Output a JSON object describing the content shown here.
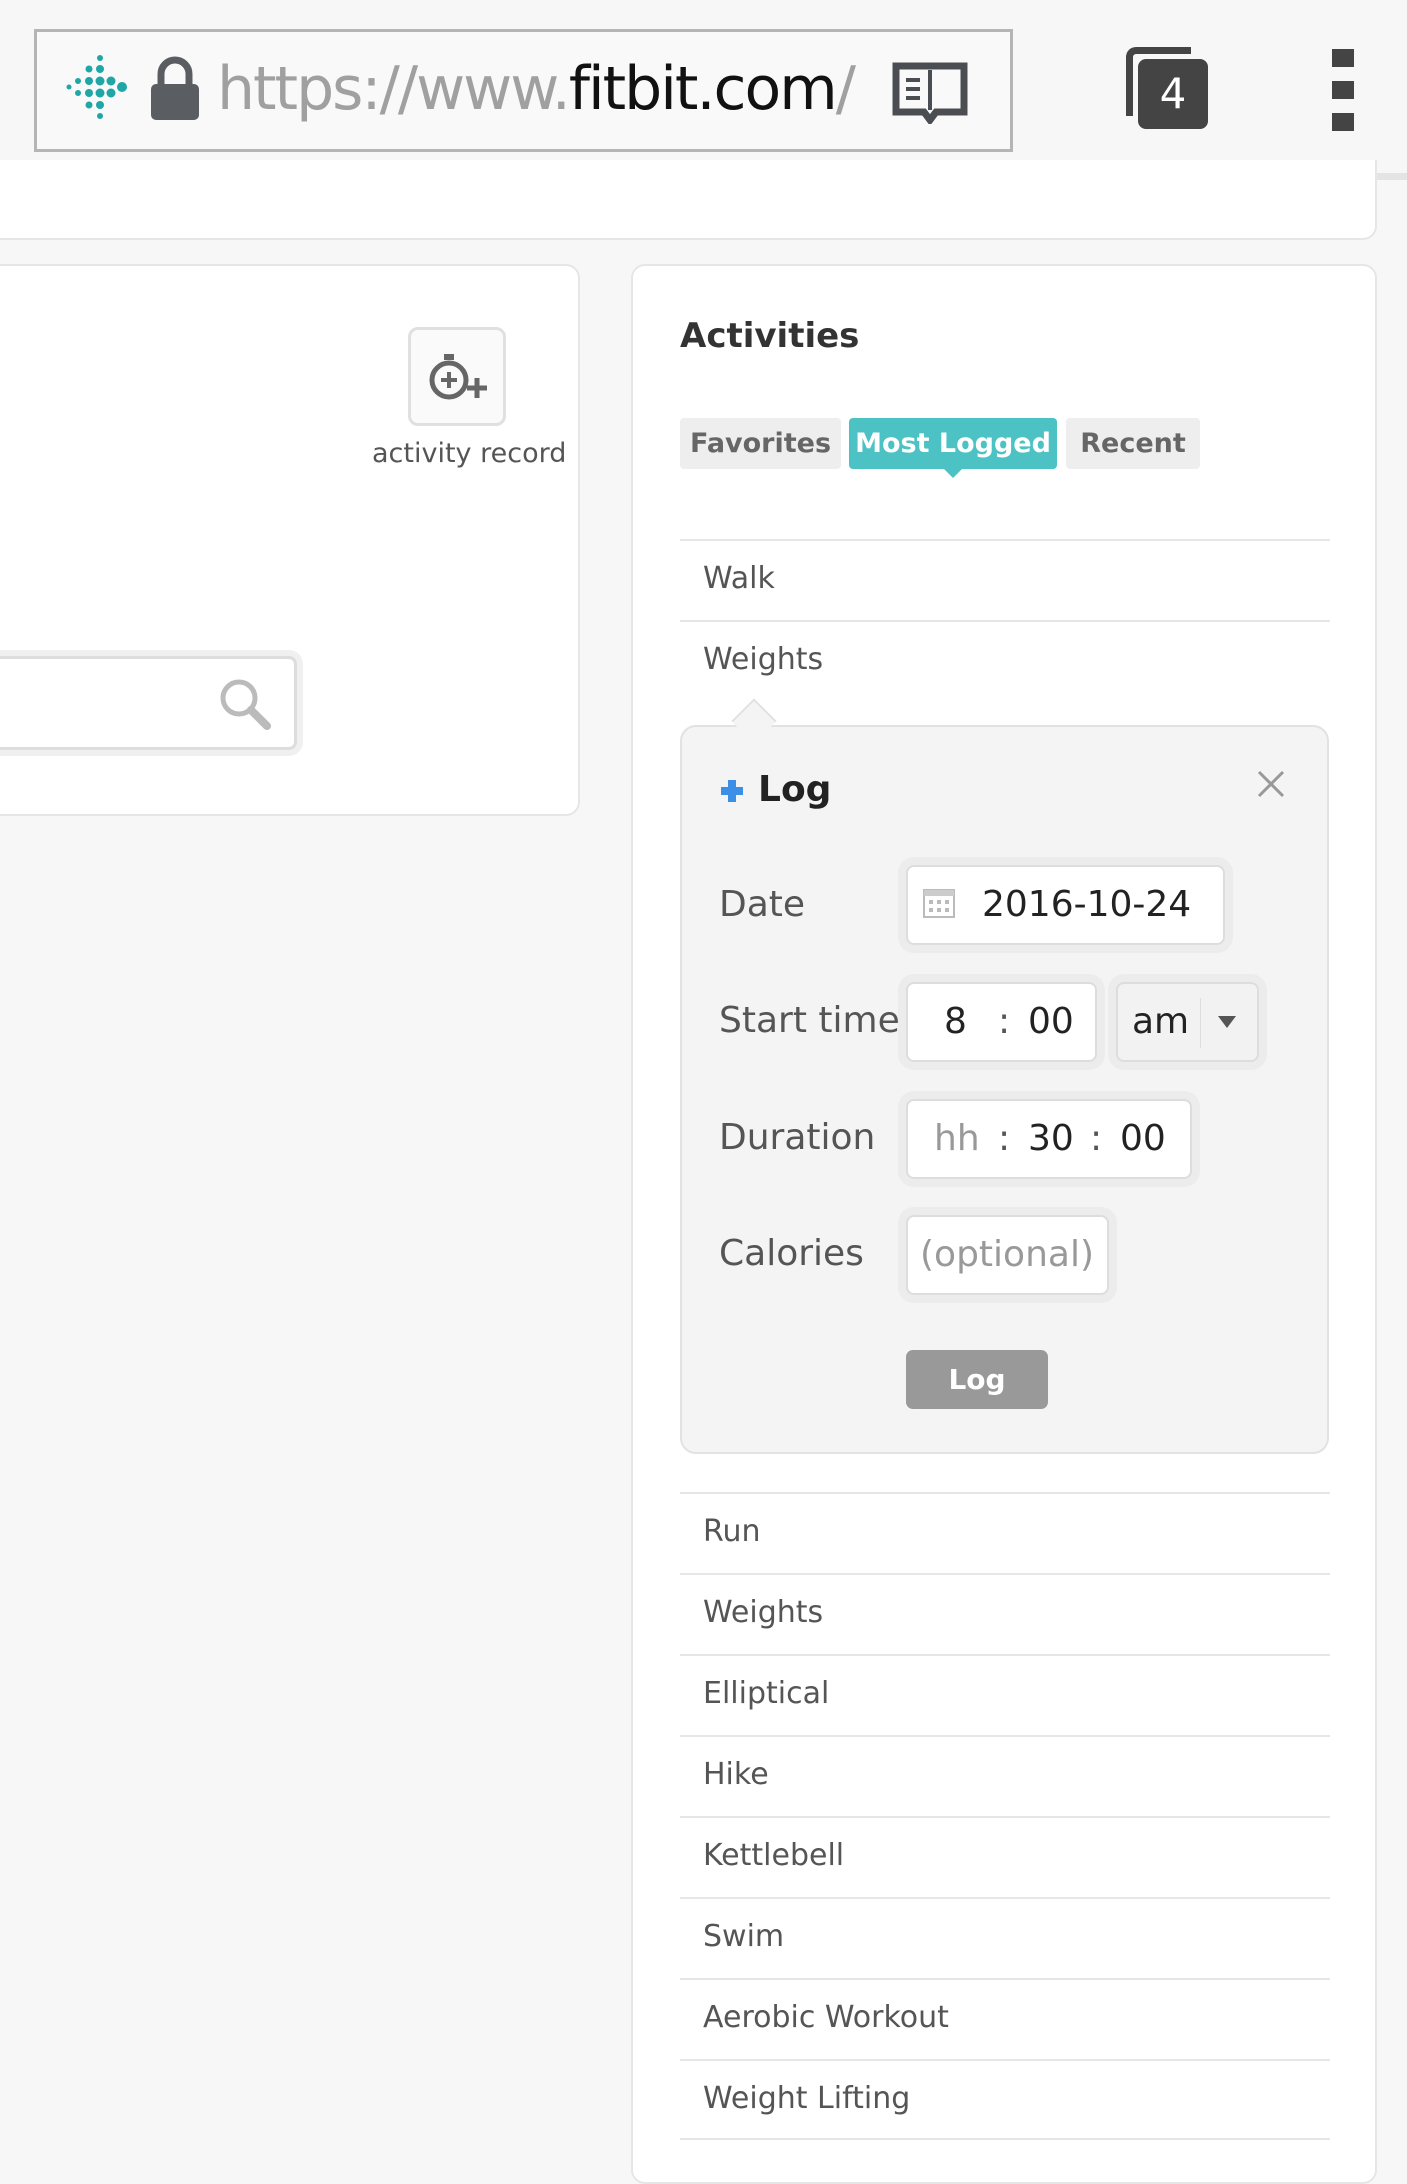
{
  "browser": {
    "url_scheme": "https://www.",
    "url_domain": "fitbit.com",
    "url_rest": "/",
    "tab_count": "4",
    "icons": [
      "fitbit-logo-icon",
      "lock-icon",
      "reader-mode-icon",
      "tabs-icon",
      "overflow-menu-icon"
    ]
  },
  "left_panel": {
    "activity_record_label": "activity record",
    "icons": [
      "stopwatch-plus-icon",
      "search-icon"
    ]
  },
  "activities": {
    "title": "Activities",
    "tabs": [
      {
        "label": "Favorites",
        "active": false
      },
      {
        "label": "Most Logged",
        "active": true
      },
      {
        "label": "Recent",
        "active": false
      }
    ],
    "items_before": [
      "Walk",
      "Weights"
    ],
    "items_after": [
      "Run",
      "Weights",
      "Elliptical",
      "Hike",
      "Kettlebell",
      "Swim",
      "Aerobic Workout",
      "Weight Lifting"
    ],
    "accent_color": "#4cc2c4"
  },
  "log_form": {
    "title": "Log",
    "date_label": "Date",
    "date_value": "2016-10-24",
    "start_time_label": "Start time",
    "start_hour": "8",
    "start_minute": "00",
    "ampm": "am",
    "duration_label": "Duration",
    "duration_hours_placeholder": "hh",
    "duration_minutes": "30",
    "duration_seconds": "00",
    "calories_label": "Calories",
    "calories_placeholder": "(optional)",
    "submit_label": "Log",
    "separator": ":"
  }
}
